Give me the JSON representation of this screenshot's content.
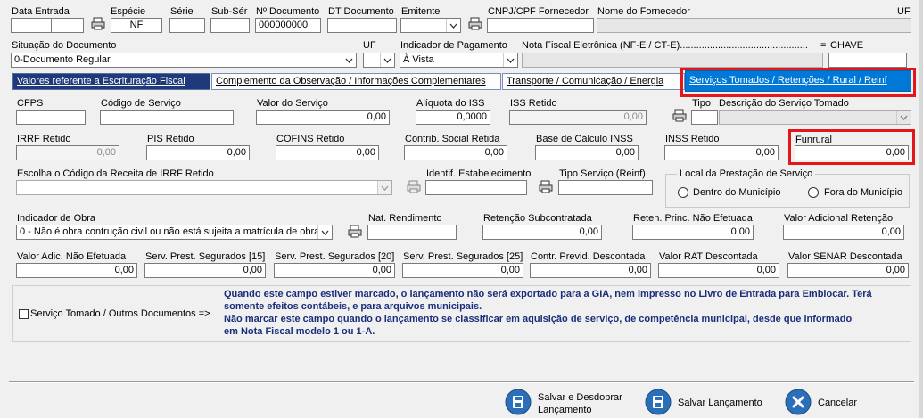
{
  "header_row": {
    "data_entrada_label": "Data Entrada",
    "especie_label": "Espécie",
    "especie_value": "NF",
    "serie_label": "Série",
    "sub_serie_label": "Sub-Sér",
    "num_documento_label": "Nº Documento",
    "num_documento_value": "000000000",
    "dt_documento_label": "DT Documento",
    "emitente_label": "Emitente",
    "cnpj_label": "CNPJ/CPF Fornecedor",
    "nome_fornecedor_label": "Nome do Fornecedor",
    "uf_label": "UF"
  },
  "row2": {
    "situacao_label": "Situação do Documento",
    "situacao_value": "0-Documento Regular",
    "uf_label": "UF",
    "indicador_pagamento_label": "Indicador de Pagamento",
    "indicador_pagamento_value": "À Vista",
    "nfe_label": "Nota Fiscal Eletrônica (NF-E / CT-E)...............................................",
    "equals": "=",
    "chave_label": "CHAVE"
  },
  "tabs": [
    {
      "label": "Valores referente a Escrituração Fiscal"
    },
    {
      "label": "Complemento da Observação / Informações Complementares"
    },
    {
      "label": "Transporte / Comunicação / Energia"
    },
    {
      "label": "Serviços Tomados / Retenções / Rural / Reinf"
    }
  ],
  "servicos": {
    "cfps_label": "CFPS",
    "codigo_servico_label": "Código de Serviço",
    "valor_servico_label": "Valor do Serviço",
    "valor_servico_value": "0,00",
    "aliquota_iss_label": "Alíquota do ISS",
    "aliquota_iss_value": "0,0000",
    "iss_retido_label": "ISS Retido",
    "iss_retido_value": "0,00",
    "tipo_label": "Tipo",
    "descricao_label": "Descrição do Serviço Tomado"
  },
  "retencoes": {
    "irrf_label": "IRRF Retido",
    "irrf_value": "0,00",
    "pis_label": "PIS Retido",
    "pis_value": "0,00",
    "cofins_label": "COFINS Retido",
    "cofins_value": "0,00",
    "csll_label": "Contrib. Social Retida",
    "csll_value": "0,00",
    "base_inss_label": "Base de Cálculo INSS",
    "base_inss_value": "0,00",
    "inss_label": "INSS Retido",
    "inss_value": "0,00",
    "funrural_label": "Funrural",
    "funrural_value": "0,00"
  },
  "receita": {
    "escolha_label": "Escolha o Código da Receita de IRRF Retido",
    "identif_label": "Identif. Estabelecimento",
    "tipo_servico_label": "Tipo Serviço (Reinf)",
    "local_group_label": "Local da Prestação de Serviço",
    "dentro_label": "Dentro do Município",
    "fora_label": "Fora do Município"
  },
  "obra": {
    "indicador_obra_label": "Indicador de Obra",
    "indicador_obra_value": "0 - Não é obra contrução civil ou não está sujeita a matrícula de obra",
    "nat_rendimento_label": "Nat. Rendimento",
    "retencao_sub_label": "Retenção Subcontratada",
    "retencao_sub_value": "0,00",
    "reten_princ_label": "Reten. Princ. Não Efetuada",
    "reten_princ_value": "0,00",
    "valor_adic_ret_label": "Valor Adicional Retenção",
    "valor_adic_ret_value": "0,00"
  },
  "adicionais": {
    "valor_adic_nao_label": "Valor Adic. Não Efetuada",
    "valor_adic_nao_value": "0,00",
    "serv15_label": "Serv. Prest. Segurados [15]",
    "serv15_value": "0,00",
    "serv20_label": "Serv. Prest. Segurados [20]",
    "serv20_value": "0,00",
    "serv25_label": "Serv. Prest. Segurados [25]",
    "serv25_value": "0,00",
    "contr_previd_label": "Contr. Previd. Descontada",
    "contr_previd_value": "0,00",
    "rat_label": "Valor RAT Descontada",
    "rat_value": "0,00",
    "senar_label": "Valor SENAR Descontada",
    "senar_value": "0,00"
  },
  "servico_tomado": {
    "checkbox_label": "Serviço Tomado / Outros Documentos  =>",
    "note_line1": "Quando este campo estiver marcado, o lançamento não será exportado para a GIA, nem impresso no Livro de Entrada para Emblocar. Terá",
    "note_line2": "somente efeitos contábeis, e para arquivos municipais.",
    "note_line3": "Não marcar este campo quando o lançamento se classificar em aquisição de serviço, de competência municipal, desde que informado",
    "note_line4": "em Nota Fiscal modelo 1 ou 1-A."
  },
  "footer": {
    "salvar_desdobrar_line1": "Salvar e Desdobrar",
    "salvar_desdobrar_line2": "Lançamento",
    "salvar_label": "Salvar Lançamento",
    "cancelar_label": "Cancelar"
  },
  "colors": {
    "tab_dark": "#1f3a7a",
    "tab_active": "#0078d7",
    "highlight": "#e3161c",
    "note_text": "#1a2e7a"
  }
}
